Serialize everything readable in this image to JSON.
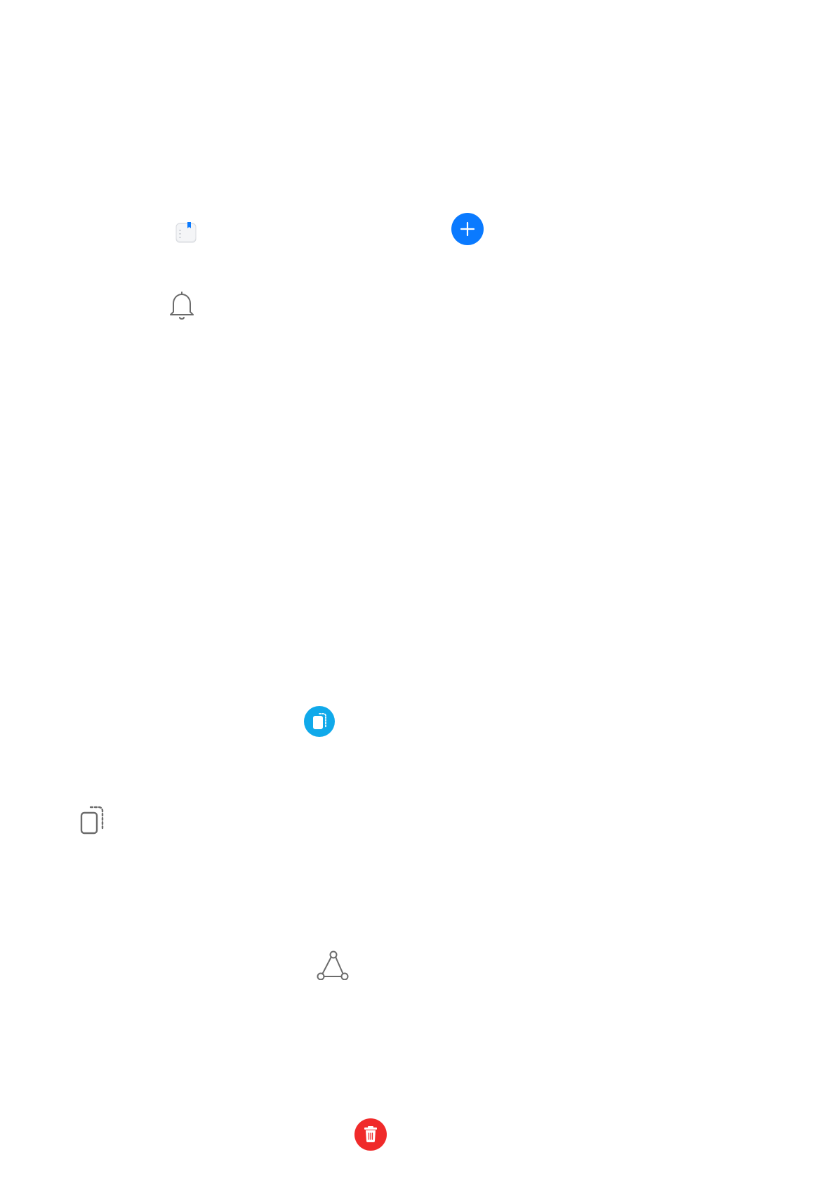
{
  "icons": [
    {
      "name": "notes-app-icon",
      "interactable": true
    },
    {
      "name": "add-icon",
      "interactable": true
    },
    {
      "name": "bell-icon",
      "interactable": false
    },
    {
      "name": "clipboard-icon",
      "interactable": true
    },
    {
      "name": "clipboard-outline-icon",
      "interactable": false
    },
    {
      "name": "vector-path-icon",
      "interactable": false
    },
    {
      "name": "trash-icon",
      "interactable": true
    }
  ],
  "colors": {
    "background": "#ffffff",
    "add_button": "#0a7aff",
    "clipboard_button": "#10a9ea",
    "delete_button": "#f02a2a",
    "outline_gray": "#6b6b6b",
    "notes_bookmark": "#0a7aff"
  }
}
